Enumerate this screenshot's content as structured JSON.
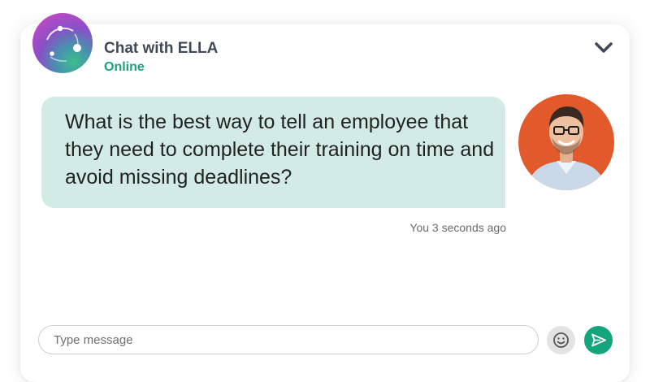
{
  "header": {
    "title": "Chat with ELLA",
    "status": "Online",
    "collapse_icon": "chevron-down-icon"
  },
  "messages": [
    {
      "text": "What is the best way to tell an employee that they need to complete their training on time and avoid missing deadlines?",
      "meta": "You 3 seconds ago"
    }
  ],
  "composer": {
    "placeholder": "Type message",
    "emoji_icon": "smiley-icon",
    "send_icon": "send-icon"
  },
  "colors": {
    "accent": "#14a57c",
    "status": "#18a57a",
    "bubble": "#d2ebe5",
    "title": "#3e4a57",
    "user_avatar_bg": "#e25a2b"
  }
}
